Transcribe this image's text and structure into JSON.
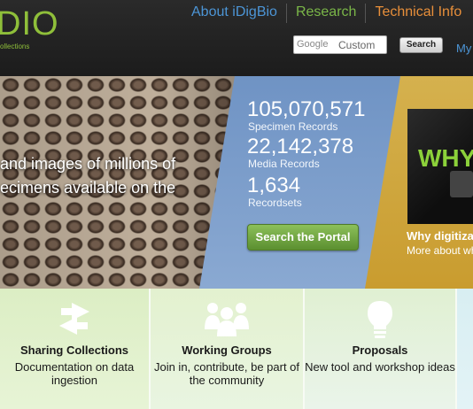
{
  "header": {
    "logo": "iDigBio",
    "logo_visible": "DIO",
    "logo_sub": "ollections",
    "nav": [
      {
        "label": "About iDigBio"
      },
      {
        "label": "Research"
      },
      {
        "label": "Technical Info"
      }
    ],
    "search": {
      "brand": "Google",
      "value": "Custom",
      "button": "Search"
    },
    "my_link": "My"
  },
  "hero": {
    "text": "and images of millions of ecimens available on the",
    "stats": [
      {
        "value": "105,070,571",
        "label": "Specimen Records"
      },
      {
        "value": "22,142,378",
        "label": "Media Records"
      },
      {
        "value": "1,634",
        "label": "Recordsets"
      }
    ],
    "portal_button": "Search the Portal",
    "video": {
      "thumb_text": "WHY",
      "title": "Why digitiza",
      "subtitle": "More about wh"
    }
  },
  "tiles": [
    {
      "icon": "exchange-arrows-icon",
      "title": "Sharing Collections",
      "desc": "Documentation on data ingestion"
    },
    {
      "icon": "people-group-icon",
      "title": "Working Groups",
      "desc": "Join in, contribute, be part of the community"
    },
    {
      "icon": "lightbulb-icon",
      "title": "Proposals",
      "desc": "New tool and workshop ideas"
    }
  ],
  "colors": {
    "nav_about": "#4c95d6",
    "nav_research": "#7ab648",
    "nav_technical": "#e88f3a",
    "logo_green": "#8fbf3a",
    "portal_button": "#6fa543"
  }
}
